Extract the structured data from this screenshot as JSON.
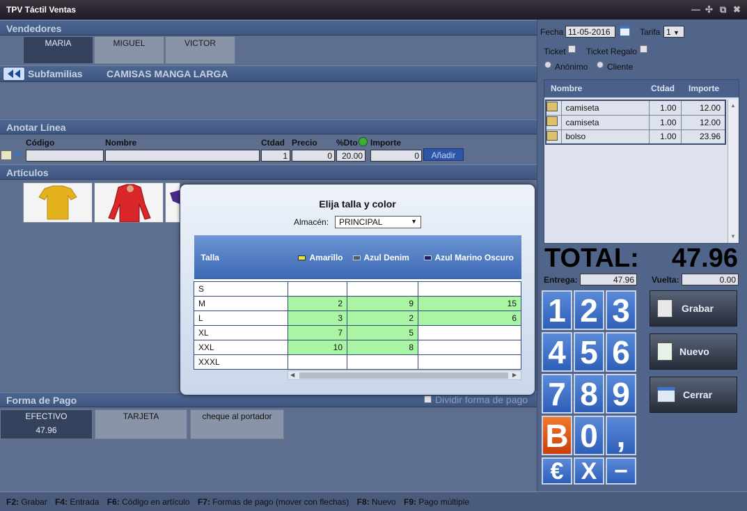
{
  "window": {
    "title": "TPV Táctil Ventas",
    "controls": [
      "—",
      "✣",
      "⧉",
      "✖"
    ]
  },
  "vendedores": {
    "header": "Vendedores",
    "items": [
      "MARIA",
      "MIGUEL",
      "VICTOR"
    ],
    "selected": "MARIA"
  },
  "subfamilias": {
    "label": "Subfamilias",
    "current": "CAMISAS MANGA LARGA"
  },
  "anotar": {
    "header": "Anotar Línea",
    "col_codigo": "Código",
    "col_nombre": "Nombre",
    "col_ctdad": "Ctdad",
    "col_precio": "Precio",
    "col_dto": "%Dto",
    "col_importe": "Importe",
    "codigo": "",
    "nombre": "",
    "ctdad": "1",
    "precio": "0",
    "dto": "20.00",
    "importe": "0",
    "add_label": "Añadir"
  },
  "articulos": {
    "header": "Artículos",
    "items": [
      "camiseta-amarilla",
      "camisa-roja",
      "prenda-morada"
    ]
  },
  "forma_pago": {
    "header": "Forma de Pago",
    "dividir": "Dividir forma de pago",
    "methods": [
      {
        "label": "EFECTIVO",
        "amount": "47.96"
      },
      {
        "label": "TARJETA",
        "amount": ""
      },
      {
        "label": "cheque al portador",
        "amount": ""
      }
    ]
  },
  "status": [
    {
      "key": "F2:",
      "text": "Grabar"
    },
    {
      "key": "F4:",
      "text": "Entrada"
    },
    {
      "key": "F6:",
      "text": "Código en artículo"
    },
    {
      "key": "F7:",
      "text": "Formas de pago (mover con flechas)"
    },
    {
      "key": "F8:",
      "text": "Nuevo"
    },
    {
      "key": "F9:",
      "text": "Pago múltiple"
    }
  ],
  "ticket": {
    "fecha_label": "Fecha",
    "fecha": "11-05-2016",
    "tarifa_label": "Tarifa",
    "tarifa": "1",
    "ticket_label": "Ticket",
    "regalo_label": "Ticket Regalo",
    "anonimo_label": "Anónimo",
    "cliente_label": "Cliente",
    "col_nombre": "Nombre",
    "col_ctdad": "Ctdad",
    "col_importe": "Importe",
    "lines": [
      {
        "nombre": "camiseta",
        "ctdad": "1.00",
        "importe": "12.00"
      },
      {
        "nombre": "camiseta",
        "ctdad": "1.00",
        "importe": "12.00"
      },
      {
        "nombre": "bolso",
        "ctdad": "1.00",
        "importe": "23.96"
      }
    ],
    "total_label": "TOTAL:",
    "total": "47.96",
    "entrega_label": "Entrega:",
    "entrega": "47.96",
    "vuelta_label": "Vuelta:",
    "vuelta": "0.00"
  },
  "keypad": {
    "digits": [
      "1",
      "2",
      "3",
      "4",
      "5",
      "6",
      "7",
      "8",
      "9",
      "B",
      "0",
      ","
    ],
    "bottom": [
      "€",
      "X",
      "−"
    ]
  },
  "actions": {
    "grabar": "Grabar",
    "nuevo": "Nuevo",
    "cerrar": "Cerrar"
  },
  "modal": {
    "title": "Elija talla y color",
    "almacen_label": "Almacén:",
    "almacen": "PRINCIPAL",
    "talla_header": "Talla",
    "colors": [
      {
        "name": "Amarillo",
        "swatch": "#e8e23a"
      },
      {
        "name": "Azul Denim",
        "swatch": "#4a5a70"
      },
      {
        "name": "Azul Marino Oscuro",
        "swatch": "#1a2270"
      }
    ],
    "rows": [
      {
        "talla": "S",
        "values": [
          "",
          "",
          ""
        ]
      },
      {
        "talla": "M",
        "values": [
          "2",
          "9",
          "15"
        ]
      },
      {
        "talla": "L",
        "values": [
          "3",
          "2",
          "6"
        ]
      },
      {
        "talla": "XL",
        "values": [
          "7",
          "5",
          ""
        ]
      },
      {
        "talla": "XXL",
        "values": [
          "10",
          "8",
          ""
        ]
      },
      {
        "talla": "XXXL",
        "values": [
          "",
          "",
          ""
        ]
      }
    ]
  }
}
